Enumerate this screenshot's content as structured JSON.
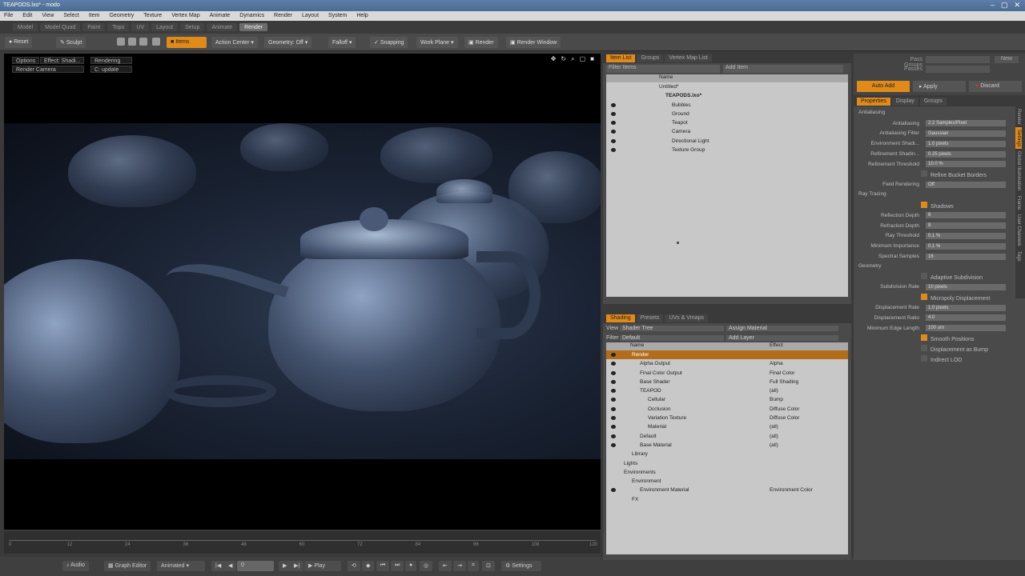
{
  "window": {
    "title": "TEAPODS.lxo* - modo",
    "buttons": [
      "–",
      "▢",
      "✕"
    ]
  },
  "menu": [
    "File",
    "Edit",
    "View",
    "Select",
    "Item",
    "Geometry",
    "Texture",
    "Vertex Map",
    "Animate",
    "Dynamics",
    "Render",
    "Layout",
    "System",
    "Help"
  ],
  "layout_tabs": [
    "Model",
    "Model Quad",
    "Paint",
    "Topo",
    "UV",
    "Layout",
    "Setup",
    "Animate",
    "Render"
  ],
  "active_layout_tab": "Render",
  "toolbar": {
    "reset": "Reset",
    "sculpt": "Sculpt",
    "items": "Items",
    "action_center": "Action Center",
    "geometry": "Geometry: Off",
    "falloff": "Falloff",
    "snapping": "Snapping",
    "work_plane": "Work Plane",
    "render": "Render",
    "render_window": "Render Window"
  },
  "viewport": {
    "options": "Options",
    "effect": "Effect: Shadi...",
    "rendering": "Rendering",
    "camera": "Render Camera",
    "update": "C: update",
    "icons": [
      "✥",
      "↻",
      "⌕",
      "▢",
      "■"
    ]
  },
  "timeline": {
    "ticks": [
      "0",
      "12",
      "24",
      "36",
      "48",
      "60",
      "72",
      "84",
      "96",
      "108",
      "120"
    ]
  },
  "bottombar": {
    "audio": "Audio",
    "graph_editor": "Graph Editor",
    "animated": "Animated",
    "frame": "0",
    "play": "Play",
    "settings": "Settings"
  },
  "item_list": {
    "tabs": [
      "Item List",
      "Groups",
      "Vertex Map List"
    ],
    "active_tab": "Item List",
    "filter": "Filter Items",
    "add": "Add Item",
    "column": "Name",
    "items": [
      {
        "label": "Untitled*",
        "indent": 0
      },
      {
        "label": "TEAPODS.lxo*",
        "indent": 1,
        "bold": true
      },
      {
        "label": "Bubbles",
        "indent": 2
      },
      {
        "label": "Ground",
        "indent": 2
      },
      {
        "label": "Teapot",
        "indent": 2
      },
      {
        "label": "Camera",
        "indent": 2
      },
      {
        "label": "Directional Light",
        "indent": 2
      },
      {
        "label": "Texture Group",
        "indent": 2
      }
    ]
  },
  "shader": {
    "tabs": [
      "Shading",
      "Presets",
      "UVs & Vmaps"
    ],
    "active_tab": "Shading",
    "view_label": "View",
    "view": "Shader Tree",
    "assign": "Assign Material",
    "filter_label": "Filter",
    "filter": "Default",
    "add_layer": "Add Layer",
    "columns": [
      "Name",
      "Effect"
    ],
    "rows": [
      {
        "name": "Render",
        "effect": "",
        "indent": 1
      },
      {
        "name": "Alpha Output",
        "effect": "Alpha",
        "indent": 2
      },
      {
        "name": "Final Color Output",
        "effect": "Final Color",
        "indent": 2
      },
      {
        "name": "Base Shader",
        "effect": "Full Shading",
        "indent": 2
      },
      {
        "name": "TEAPOD",
        "effect": "(all)",
        "indent": 2
      },
      {
        "name": "Cellular",
        "effect": "Bump",
        "indent": 3
      },
      {
        "name": "Occlusion",
        "effect": "Diffuse Color",
        "indent": 3
      },
      {
        "name": "Variation Texture",
        "effect": "Diffuse Color",
        "indent": 3
      },
      {
        "name": "Material",
        "effect": "(all)",
        "indent": 3
      },
      {
        "name": "Default",
        "effect": "(all)",
        "indent": 2
      },
      {
        "name": "Base Material",
        "effect": "(all)",
        "indent": 2
      },
      {
        "name": "Library",
        "effect": "",
        "indent": 1
      },
      {
        "name": "Lights",
        "effect": "",
        "indent": 0
      },
      {
        "name": "Environments",
        "effect": "",
        "indent": 0
      },
      {
        "name": "Environment",
        "effect": "",
        "indent": 1
      },
      {
        "name": "Environment Material",
        "effect": "Environment Color",
        "indent": 2
      },
      {
        "name": "FX",
        "effect": "",
        "indent": 1
      }
    ]
  },
  "right_top": {
    "pass_groups": "Pass Groups",
    "passes": "Passes",
    "new": "New",
    "auto_add": "Auto Add",
    "apply": "Apply",
    "discard": "Discard"
  },
  "properties": {
    "tabs": [
      "Properties",
      "Display",
      "Groups"
    ],
    "active_tab": "Properties",
    "side_tabs": [
      "Render",
      "Settings",
      "Global Illumination",
      "Frame",
      "User Channels",
      "Tags"
    ],
    "sections": [
      {
        "title": "Antialiasing",
        "props": [
          {
            "label": "Antialiasing",
            "value": "2:2 Samples/Pixel"
          },
          {
            "label": "Antialiasing Filter",
            "value": "Gaussian"
          },
          {
            "label": "Environment Shadi...",
            "value": "1.0 pixels"
          },
          {
            "label": "Refinement Shadin...",
            "value": "0.25 pixels"
          },
          {
            "label": "Refinement Threshold",
            "value": "10.0 %"
          },
          {
            "label": "",
            "value": "Refine Bucket Borders",
            "check": false
          },
          {
            "label": "Field Rendering",
            "value": "Off"
          }
        ]
      },
      {
        "title": "Ray Tracing",
        "props": [
          {
            "label": "",
            "value": "Shadows",
            "check": true
          },
          {
            "label": "Reflection Depth",
            "value": "8"
          },
          {
            "label": "Refraction Depth",
            "value": "8"
          },
          {
            "label": "Ray Threshold",
            "value": "0.1 %"
          },
          {
            "label": "Minimum Importance",
            "value": "0.1 %"
          },
          {
            "label": "Spectral Samples",
            "value": "16"
          }
        ]
      },
      {
        "title": "Geometry",
        "props": [
          {
            "label": "",
            "value": "Adaptive Subdivision",
            "check": false
          },
          {
            "label": "Subdivision Rate",
            "value": "10 pixels"
          },
          {
            "label": "",
            "value": "Micropoly Displacement",
            "check": true
          },
          {
            "label": "Displacement Rate",
            "value": "1.0 pixels"
          },
          {
            "label": "Displacement Ratio",
            "value": "4.0"
          },
          {
            "label": "Minimum Edge Length",
            "value": "100 um"
          },
          {
            "label": "",
            "value": "Smooth Positions",
            "check": true
          },
          {
            "label": "",
            "value": "Displacement as Bump",
            "check": false
          },
          {
            "label": "",
            "value": "Indirect LOD",
            "check": false
          }
        ]
      }
    ]
  },
  "colors": {
    "accent": "#e08a1a",
    "panel": "#4a4a4a",
    "list": "#c8c8c8"
  }
}
